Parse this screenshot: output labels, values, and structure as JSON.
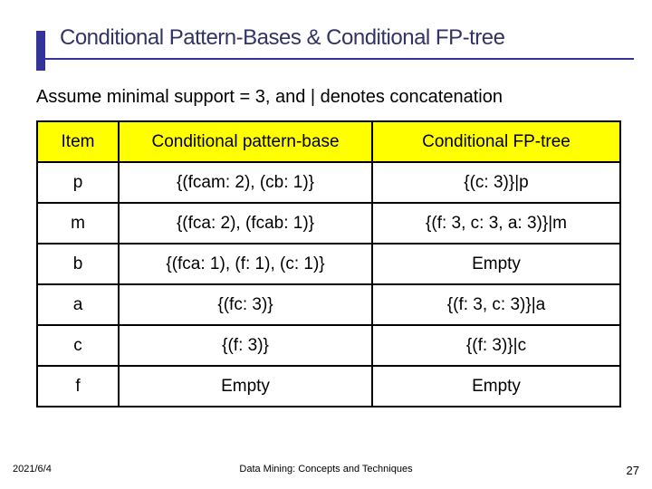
{
  "title": "Conditional Pattern-Bases & Conditional FP-tree",
  "subtitle": "Assume minimal support = 3, and | denotes concatenation",
  "table": {
    "headers": [
      "Item",
      "Conditional pattern-base",
      "Conditional FP-tree"
    ],
    "rows": [
      {
        "item": "p",
        "base": "{(fcam: 2), (cb: 1)}",
        "tree": "{(c: 3)}|p"
      },
      {
        "item": "m",
        "base": "{(fca: 2), (fcab: 1)}",
        "tree": "{(f: 3, c: 3, a: 3)}|m"
      },
      {
        "item": "b",
        "base": "{(fca: 1), (f: 1), (c: 1)}",
        "tree": "Empty"
      },
      {
        "item": "a",
        "base": "{(fc: 3)}",
        "tree": "{(f: 3, c: 3)}|a"
      },
      {
        "item": "c",
        "base": "{(f: 3)}",
        "tree": "{(f: 3)}|c"
      },
      {
        "item": "f",
        "base": "Empty",
        "tree": "Empty"
      }
    ]
  },
  "footer": {
    "date": "2021/6/4",
    "center": "Data Mining: Concepts and Techniques",
    "page": "27"
  }
}
